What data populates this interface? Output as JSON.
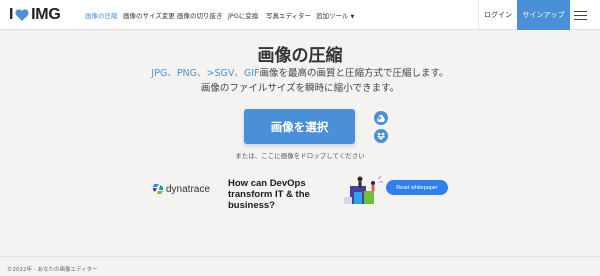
{
  "nav": {
    "logo_prefix": "I",
    "logo_suffix": "IMG",
    "items": [
      {
        "label": "画像の圧縮"
      },
      {
        "label": "画像のサイズ変更"
      },
      {
        "label": "画像の切り抜き"
      },
      {
        "label": "JPGに変換"
      },
      {
        "label": "写真エディター"
      },
      {
        "label": "追加ツール"
      }
    ],
    "login": "ログイン",
    "signup": "サインアップ",
    "accent": "#4a90d9"
  },
  "hero": {
    "title": "画像の圧縮",
    "formats": "JPG、PNG、>SGV、GIF",
    "line1_rest": "画像を最高の画質と圧縮方式で圧縮します。",
    "line2": "画像のファイルサイズを瞬時に縮小できます。",
    "select_button": "画像を選択",
    "drop_hint": "または、ここに画像をドロップしてください"
  },
  "ad": {
    "brand": "dynatrace",
    "headline": "How can DevOps transform IT & the business?",
    "cta": "Read whitepaper"
  },
  "footer": {
    "copyright": "©2022年 - あなたの画像エディター"
  }
}
